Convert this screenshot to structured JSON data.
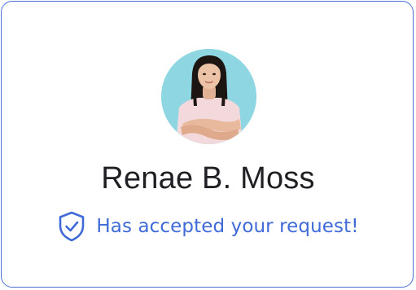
{
  "card": {
    "avatar_alt": "avatar",
    "name": "Renae B. Moss",
    "status_text": "Has accepted your request!"
  },
  "icons": {
    "status": "shield-check-icon"
  },
  "colors": {
    "accent": "#3f6ad8",
    "border": "#4a6fd4",
    "avatar_background": "#8fd6e3",
    "name_text": "#1f1f24"
  }
}
